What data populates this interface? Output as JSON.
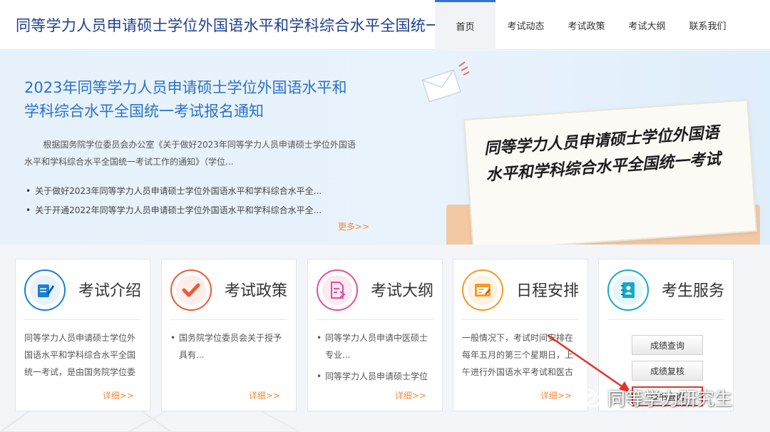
{
  "header": {
    "title": "同等学力人员申请硕士学位外国语水平和学科综合水平全国统一考试",
    "nav": [
      "首页",
      "考试动态",
      "考试政策",
      "考试大纲",
      "联系我们"
    ]
  },
  "banner": {
    "title": "2023年同等学力人员申请硕士学位外国语水平和学科综合水平全国统一考试报名通知",
    "description": "根据国务院学位委员会办公室《关于做好2023年同等学力人员申请硕士学位外国语水平和学科综合水平全国统一考试工作的通知》（学位...",
    "items": [
      "关于做好2023年同等学力人员申请硕士学位外国语水平和学科综合水平全...",
      "关于开通2022年同等学力人员申请硕士学位外国语水平和学科综合水平全..."
    ],
    "more": "更多>>",
    "paper_text": "同等学力人员申请硕士学位外国语水平和学科综合水平全国统一考试"
  },
  "cards": [
    {
      "title": "考试介绍",
      "icon": "document-edit-icon",
      "color": "#1b7fd6",
      "body": "同等学力人员申请硕士学位外国语水平和学科综合水平全国统一考试，是由国务院学位委",
      "more": "详细>>"
    },
    {
      "title": "考试政策",
      "icon": "checkmark-icon",
      "color": "#ec5a33",
      "items": [
        "国务院学位委员会关于授予具有..."
      ],
      "more": "详细>>"
    },
    {
      "title": "考试大纲",
      "icon": "file-export-icon",
      "color": "#e0509a",
      "items": [
        "同等学力人员申请中医硕士专业...",
        "同等学力人员申请硕士学位"
      ],
      "more": "详细>>"
    },
    {
      "title": "日程安排",
      "icon": "calendar-schedule-icon",
      "color": "#f39a26",
      "body": "一般情况下，考试时间安排在每年五月的第三个星期日，上午进行外国语水平考试和医古",
      "more": "详细>>"
    },
    {
      "title": "考生服务",
      "icon": "contacts-book-icon",
      "color": "#14a9c9",
      "buttons": [
        "成绩查询",
        "成绩复核",
        "证书查询"
      ]
    }
  ],
  "watermark": {
    "text": "同等学力研究生",
    "icon": "wechat-icon"
  },
  "colors": {
    "primary": "#2a72c9",
    "accent_orange": "#f08a3c",
    "highlight_red": "#e5332a"
  }
}
